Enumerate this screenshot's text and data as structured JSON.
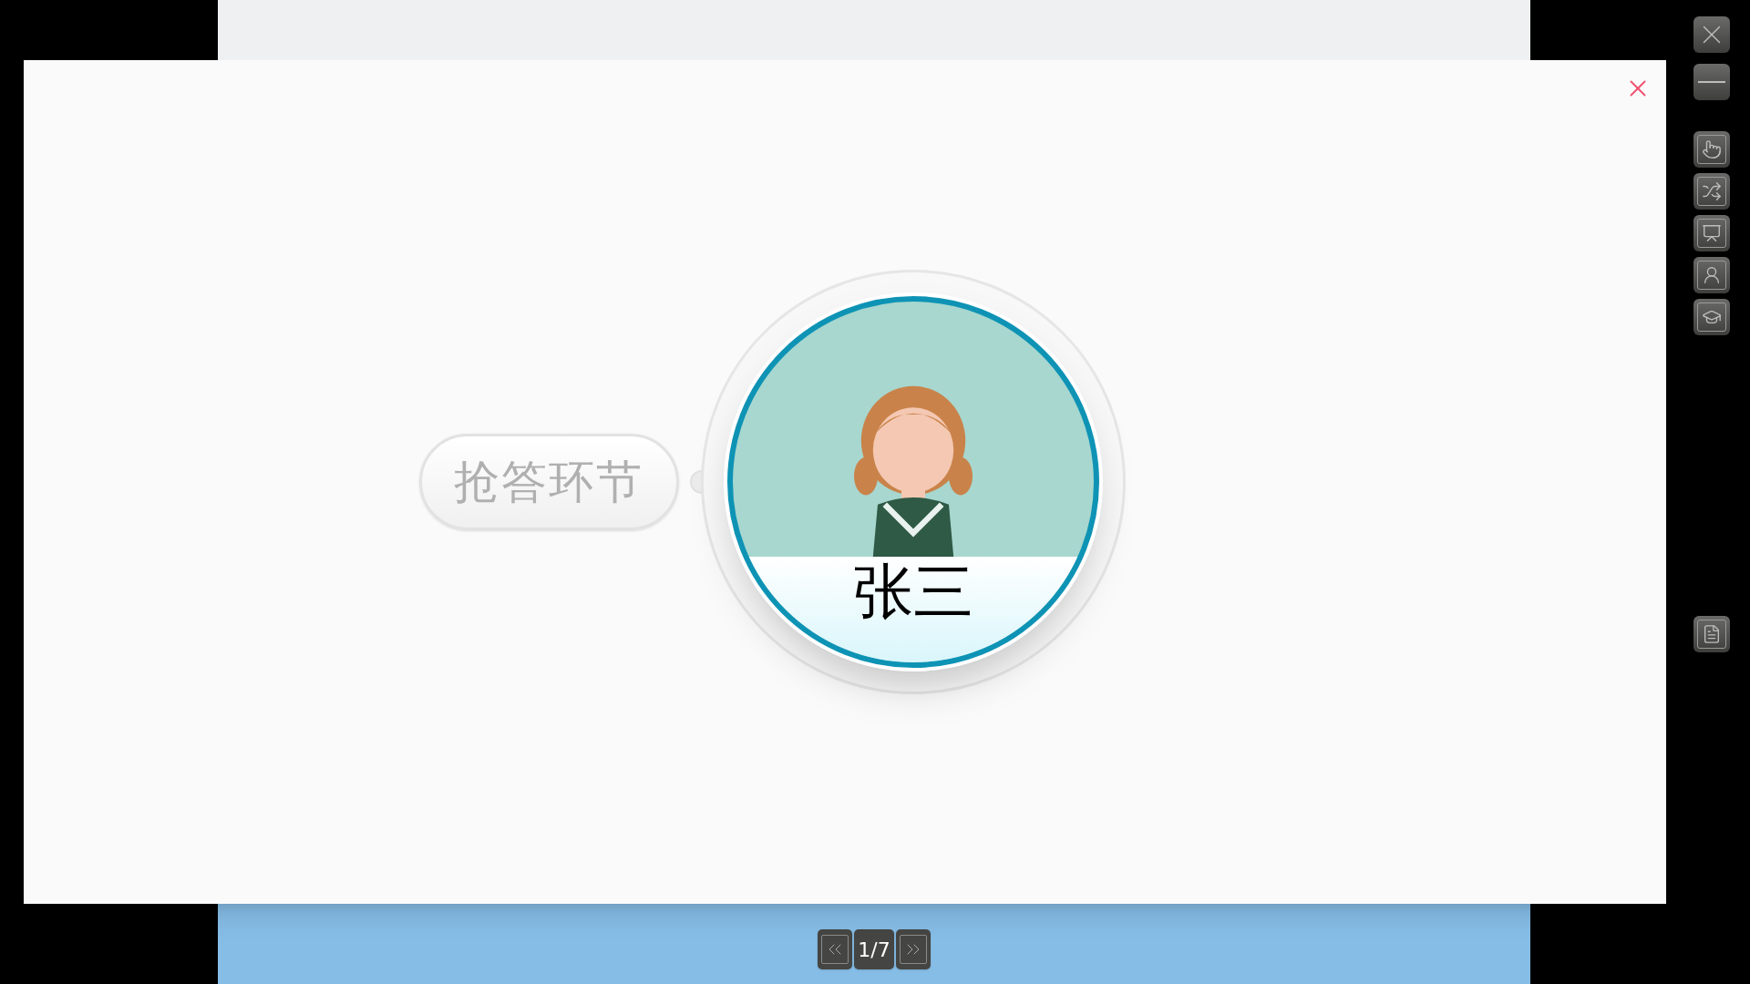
{
  "stage": {
    "label": "抢答环节",
    "student": {
      "name": "张三"
    }
  },
  "pager": {
    "page": "1/7"
  }
}
